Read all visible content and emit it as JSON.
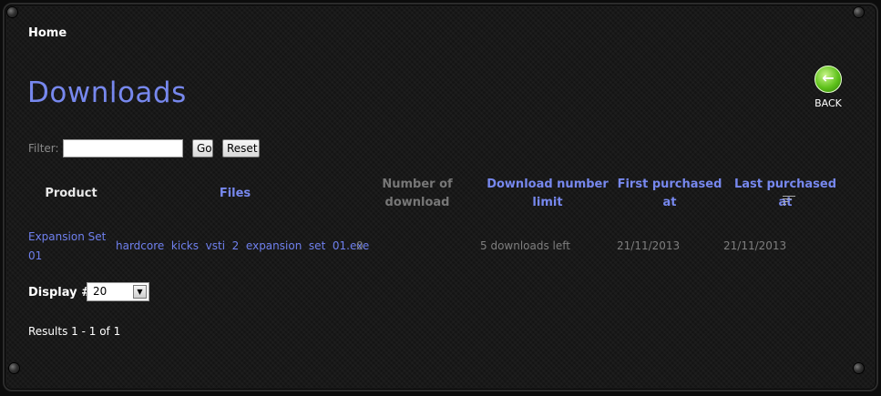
{
  "breadcrumb": {
    "home_label": "Home"
  },
  "page": {
    "title": "Downloads"
  },
  "back_button": {
    "label": "BACK"
  },
  "filter": {
    "label": "Filter:",
    "value": "",
    "go_label": "Go",
    "reset_label": "Reset"
  },
  "table": {
    "columns": {
      "product": "Product",
      "files": "Files",
      "num_download_line1": "Number of",
      "num_download_line2": "download",
      "limit_line1": "Download number",
      "limit_line2": "limit",
      "first_line1": "First purchased",
      "first_line2": "at",
      "last": "Last purchased at"
    },
    "rows": [
      {
        "product_line1": "Expansion Set",
        "product_line2": "01",
        "file": "hardcore  kicks  vsti  2  expansion  set  01.exe",
        "num_download": "0",
        "limit": "5 downloads left",
        "first_purchased": "21/11/2013",
        "last_purchased": "21/11/2013"
      }
    ]
  },
  "display": {
    "label": "Display #",
    "selected": "20"
  },
  "results": {
    "text": "Results 1 - 1 of 1"
  },
  "icons": {
    "back": "back-arrow-icon",
    "sort": "sort-descending-icon",
    "dropdown": "chevron-down-icon"
  },
  "colors": {
    "accent": "#7788ee",
    "link": "#6f80ee",
    "background": "#141414",
    "back_button": "#5fc21b"
  }
}
